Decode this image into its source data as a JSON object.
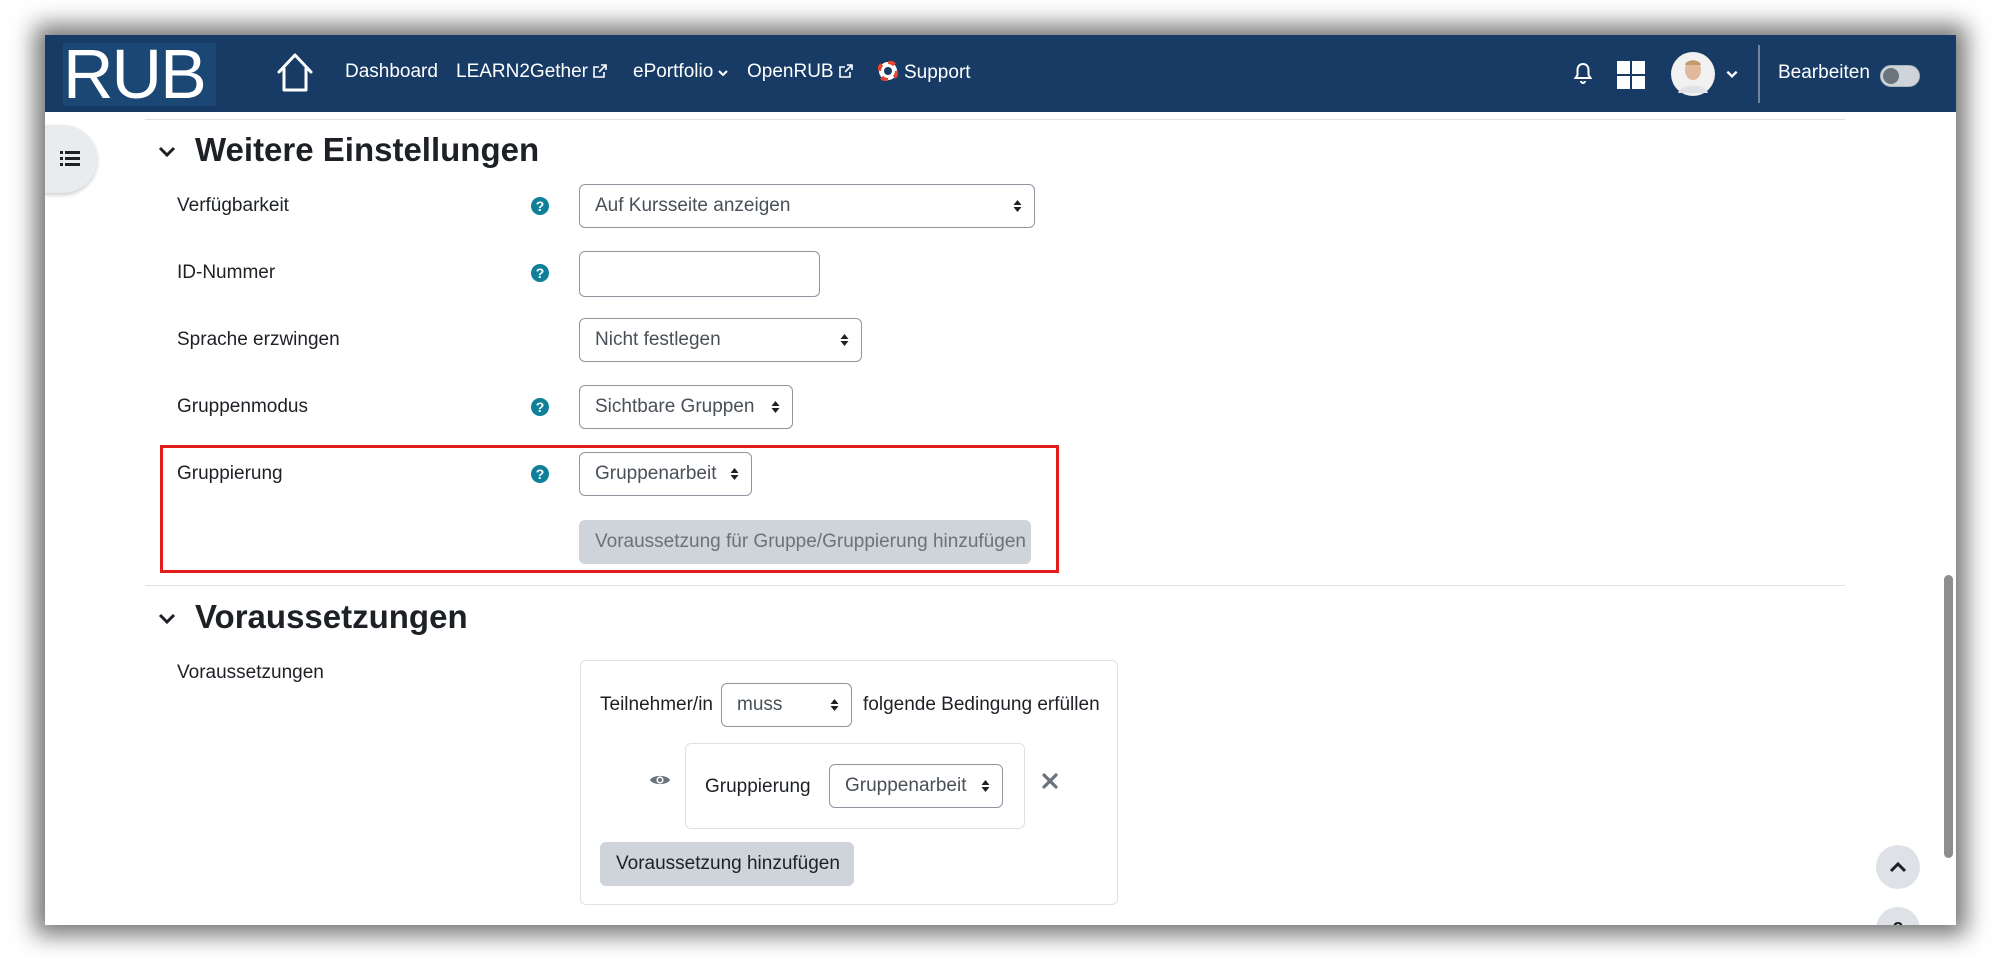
{
  "navbar": {
    "logo": "RUB",
    "links": {
      "dashboard": "Dashboard",
      "learn2gether": "LEARN2Gether",
      "eportfolio": "ePortfolio",
      "openrub": "OpenRUB",
      "support": "Support"
    },
    "edit_label": "Bearbeiten",
    "bg_color": "#173b64"
  },
  "section_weitere": {
    "title": "Weitere Einstellungen",
    "fields": {
      "verfuegbarkeit": {
        "label": "Verfügbarkeit",
        "value": "Auf Kursseite anzeigen"
      },
      "idnummer": {
        "label": "ID-Nummer",
        "value": ""
      },
      "sprache": {
        "label": "Sprache erzwingen",
        "value": "Nicht festlegen"
      },
      "gruppenmodus": {
        "label": "Gruppenmodus",
        "value": "Sichtbare Gruppen"
      },
      "gruppierung": {
        "label": "Gruppierung",
        "value": "Gruppenarbeit"
      }
    },
    "add_restriction_button": "Voraussetzung für Gruppe/Gruppierung hinzufügen"
  },
  "section_voraussetzungen": {
    "title": "Voraussetzungen",
    "label": "Voraussetzungen",
    "prefix": "Teilnehmer/in",
    "must_value": "muss",
    "suffix": "folgende Bedingung erfüllen",
    "condition": {
      "label": "Gruppierung",
      "value": "Gruppenarbeit"
    },
    "add_button": "Voraussetzung hinzufügen"
  },
  "floating": {
    "help": "?"
  },
  "colors": {
    "help_icon": "#0f7f9a",
    "highlight": "#e31b1b"
  }
}
